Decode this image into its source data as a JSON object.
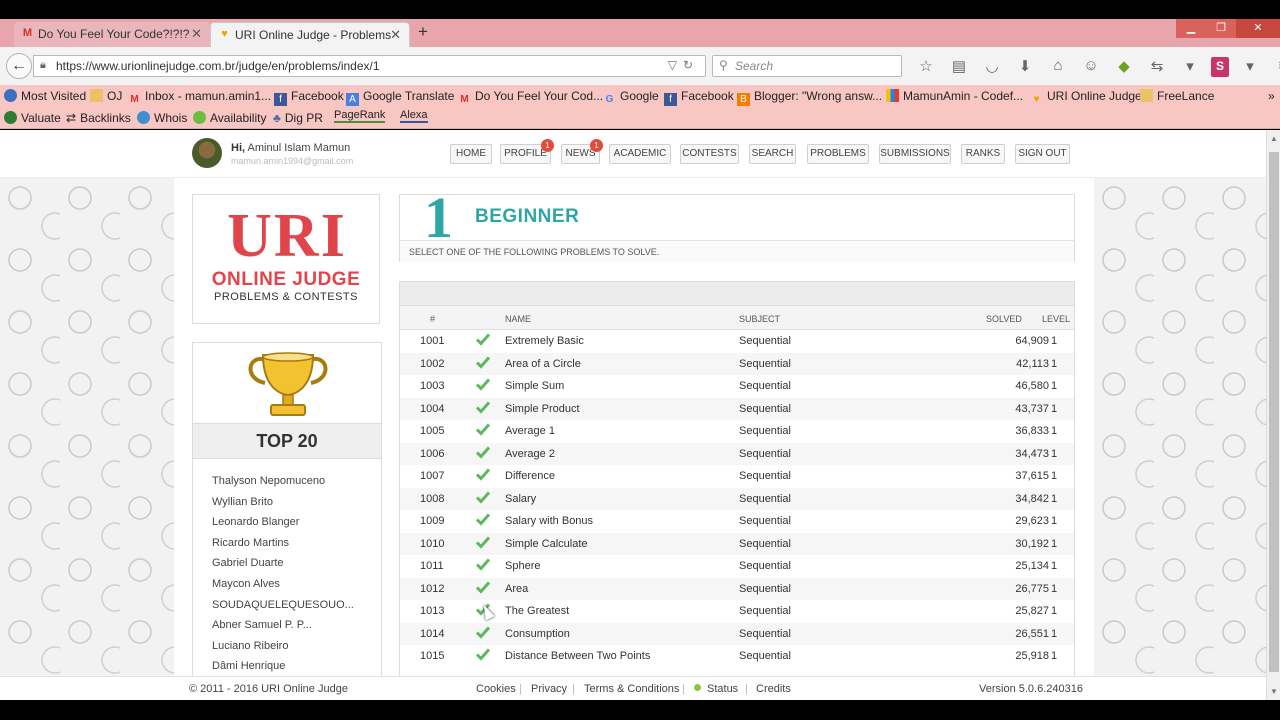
{
  "browser": {
    "tabs": [
      {
        "label": "Do You Feel Your Code?!?!?",
        "icon": "gmail-icon",
        "active": false
      },
      {
        "label": "URI Online Judge - Problems",
        "icon": "uri-favicon",
        "active": true
      }
    ],
    "url": "https://www.urionlinejudge.com.br/judge/en/problems/index/1",
    "search_placeholder": "Search",
    "bookmarks": [
      "Most Visited",
      "OJ",
      "Inbox - mamun.amin1...",
      "Facebook",
      "Google Translate",
      "Do You Feel Your Cod...",
      "Google",
      "Facebook",
      "Blogger: \"Wrong answ...",
      "MamunAmin - Codef...",
      "URI Online Judge",
      "FreeLance"
    ],
    "seo_tools": [
      "Valuate",
      "Backlinks",
      "Whois",
      "Availability",
      "Dig PR",
      "PageRank",
      "Alexa"
    ]
  },
  "header": {
    "greeting_prefix": "Hi,",
    "user_name": "Aminul Islam Mamun",
    "user_email": "mamun.amin1994@gmail.com",
    "menu": [
      {
        "label": "HOME"
      },
      {
        "label": "PROFILE",
        "badge": "1"
      },
      {
        "label": "NEWS",
        "badge": "1"
      },
      {
        "label": "ACADEMIC"
      },
      {
        "label": "CONTESTS"
      },
      {
        "label": "SEARCH"
      },
      {
        "label": "PROBLEMS"
      },
      {
        "label": "SUBMISSIONS"
      },
      {
        "label": "RANKS"
      },
      {
        "label": "SIGN OUT"
      }
    ]
  },
  "logo": {
    "uri": "URI",
    "online_judge": "ONLINE JUDGE",
    "problems_contests": "PROBLEMS & CONTESTS"
  },
  "top20": {
    "title": "TOP 20",
    "users": [
      "Thalyson Nepomuceno",
      "Wyllian Brito",
      "Leonardo Blanger",
      "Ricardo Martins",
      "Gabriel Duarte",
      "Maycon Alves",
      "SOUDAQUELEQUESOUO...",
      "Abner Samuel P. P...",
      "Luciano Ribeiro",
      "Dâmi Henrique"
    ]
  },
  "category": {
    "number": "1",
    "title": "BEGINNER",
    "subtitle": "SELECT ONE OF THE FOLLOWING PROBLEMS TO SOLVE."
  },
  "table": {
    "columns": {
      "id": "#",
      "name": "NAME",
      "subject": "SUBJECT",
      "solved": "SOLVED",
      "level": "LEVEL"
    },
    "rows": [
      {
        "id": "1001",
        "name": "Extremely Basic",
        "subject": "Sequential",
        "solved": "64,909",
        "level": "1",
        "done": true
      },
      {
        "id": "1002",
        "name": "Area of a Circle",
        "subject": "Sequential",
        "solved": "42,113",
        "level": "1",
        "done": true
      },
      {
        "id": "1003",
        "name": "Simple Sum",
        "subject": "Sequential",
        "solved": "46,580",
        "level": "1",
        "done": true
      },
      {
        "id": "1004",
        "name": "Simple Product",
        "subject": "Sequential",
        "solved": "43,737",
        "level": "1",
        "done": true
      },
      {
        "id": "1005",
        "name": "Average 1",
        "subject": "Sequential",
        "solved": "36,833",
        "level": "1",
        "done": true
      },
      {
        "id": "1006",
        "name": "Average 2",
        "subject": "Sequential",
        "solved": "34,473",
        "level": "1",
        "done": true
      },
      {
        "id": "1007",
        "name": "Difference",
        "subject": "Sequential",
        "solved": "37,615",
        "level": "1",
        "done": true
      },
      {
        "id": "1008",
        "name": "Salary",
        "subject": "Sequential",
        "solved": "34,842",
        "level": "1",
        "done": true
      },
      {
        "id": "1009",
        "name": "Salary with Bonus",
        "subject": "Sequential",
        "solved": "29,623",
        "level": "1",
        "done": true
      },
      {
        "id": "1010",
        "name": "Simple Calculate",
        "subject": "Sequential",
        "solved": "30,192",
        "level": "1",
        "done": true
      },
      {
        "id": "1011",
        "name": "Sphere",
        "subject": "Sequential",
        "solved": "25,134",
        "level": "1",
        "done": true
      },
      {
        "id": "1012",
        "name": "Area",
        "subject": "Sequential",
        "solved": "26,775",
        "level": "1",
        "done": true
      },
      {
        "id": "1013",
        "name": "The Greatest",
        "subject": "Sequential",
        "solved": "25,827",
        "level": "1",
        "done": true
      },
      {
        "id": "1014",
        "name": "Consumption",
        "subject": "Sequential",
        "solved": "26,551",
        "level": "1",
        "done": true
      },
      {
        "id": "1015",
        "name": "Distance Between Two Points",
        "subject": "Sequential",
        "solved": "25,918",
        "level": "1",
        "done": true
      }
    ]
  },
  "footer": {
    "copyright": "© 2011 - 2016 URI Online Judge",
    "links": [
      "Cookies",
      "Privacy",
      "Terms & Conditions",
      "Status",
      "Credits"
    ],
    "version": "Version 5.0.6.240316"
  },
  "colors": {
    "accent_red": "#e0454c",
    "accent_teal": "#2ea6a6",
    "check_green": "#5cb85c",
    "tab_strip": "#e8a5ab",
    "bookmark_bar": "#f8c7c4"
  }
}
